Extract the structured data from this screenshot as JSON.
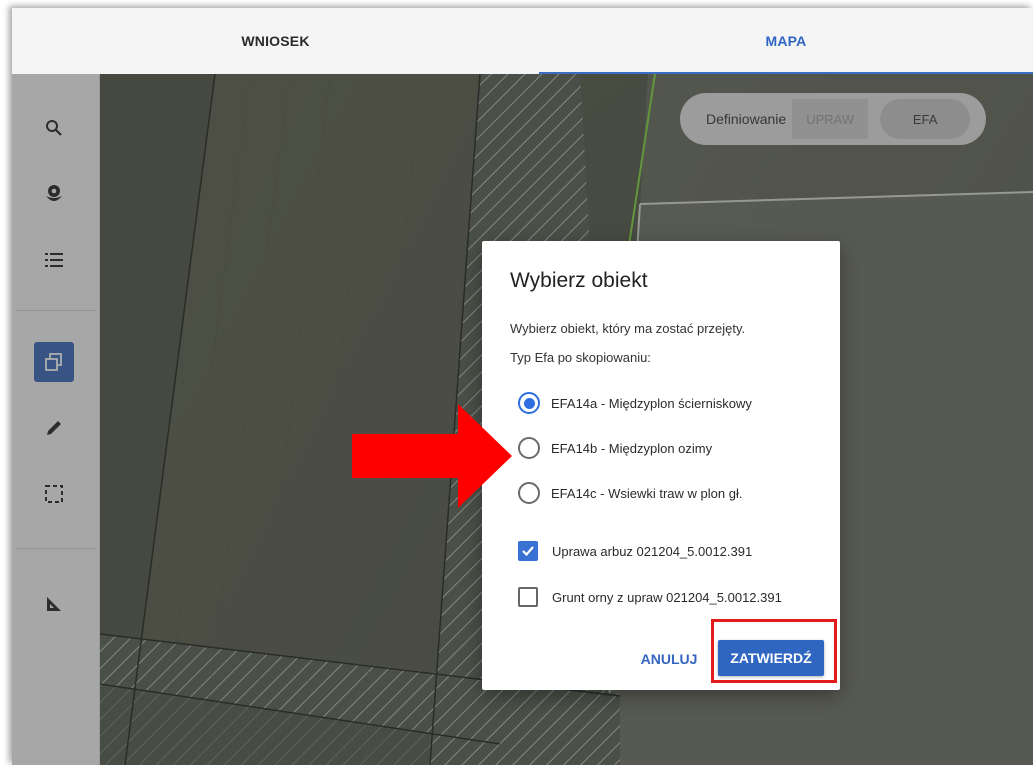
{
  "tabs": [
    {
      "label": "WNIOSEK",
      "active": false
    },
    {
      "label": "MAPA",
      "active": true
    }
  ],
  "sidebar": {
    "tools": [
      {
        "icon": "search-icon"
      },
      {
        "icon": "flower-icon"
      },
      {
        "icon": "list-icon"
      },
      {
        "icon": "copy-icon",
        "active": true
      },
      {
        "icon": "pencil-icon"
      },
      {
        "icon": "selection-icon"
      },
      {
        "icon": "ruler-icon"
      }
    ]
  },
  "toggle": {
    "label": "Definiowanie",
    "upraw": "UPRAW",
    "efa": "EFA"
  },
  "dialog": {
    "title": "Wybierz obiekt",
    "description": "Wybierz obiekt, który ma zostać przejęty.",
    "type_label": "Typ Efa po skopiowaniu:",
    "options": [
      {
        "label": "EFA14a - Międzyplon ścierniskowy",
        "checked": true
      },
      {
        "label": "EFA14b - Międzyplon ozimy",
        "checked": false
      },
      {
        "label": "EFA14c - Wsiewki traw w plon gł.",
        "checked": false
      }
    ],
    "checkboxes": [
      {
        "label": "Uprawa arbuz 021204_5.0012.391",
        "checked": true
      },
      {
        "label": "Grunt orny z upraw 021204_5.0012.391",
        "checked": false
      }
    ],
    "cancel_label": "ANULUJ",
    "confirm_label": "ZATWIERDŹ"
  },
  "colors": {
    "accent": "#2f66c2",
    "highlight": "#e31b1b",
    "arrow": "#ff0000"
  }
}
